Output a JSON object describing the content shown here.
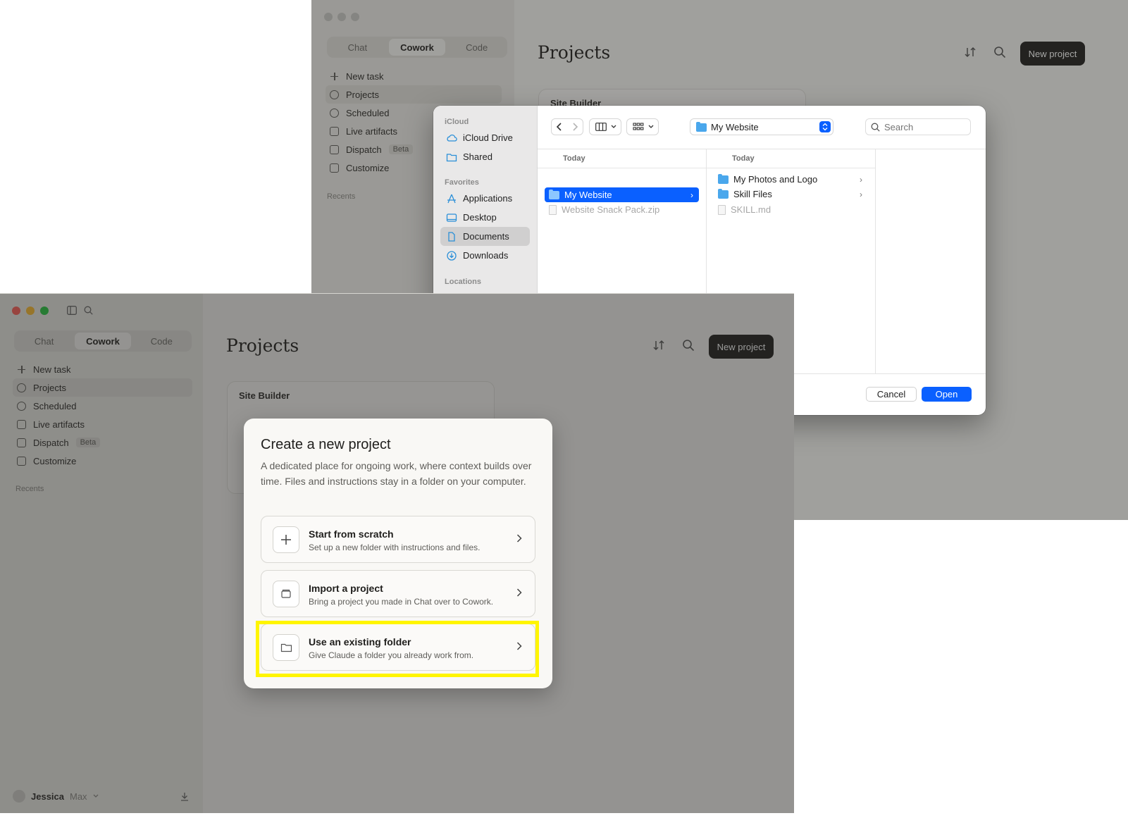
{
  "back_window": {
    "segments": [
      "Chat",
      "Cowork",
      "Code"
    ],
    "nav": [
      "New task",
      "Projects",
      "Scheduled",
      "Live artifacts",
      "Dispatch",
      "Customize"
    ],
    "beta_badge": "Beta",
    "recents_label": "Recents",
    "page_title": "Projects",
    "new_project_label": "New project",
    "card_title": "Site Builder"
  },
  "file_dialog": {
    "sidebar": {
      "icloud_header": "iCloud",
      "icloud_items": [
        "iCloud Drive",
        "Shared"
      ],
      "favorites_header": "Favorites",
      "favorite_items": [
        "Applications",
        "Desktop",
        "Documents",
        "Downloads"
      ],
      "locations_header": "Locations",
      "selected_item": "Documents"
    },
    "location": "My Website",
    "search_placeholder": "Search",
    "columns": [
      {
        "header": "Today",
        "items": [
          {
            "name": "My Website",
            "kind": "folder",
            "selected": true
          },
          {
            "name": "Website Snack Pack.zip",
            "kind": "file",
            "selected": false
          }
        ]
      },
      {
        "header": "Today",
        "items": [
          {
            "name": "My Photos and Logo",
            "kind": "folder",
            "selected": false
          },
          {
            "name": "Skill Files",
            "kind": "folder",
            "selected": false
          },
          {
            "name": "SKILL.md",
            "kind": "file",
            "selected": false
          }
        ]
      }
    ],
    "cancel_label": "Cancel",
    "open_label": "Open",
    "accent_color": "#0a60ff"
  },
  "front_window": {
    "segments": [
      "Chat",
      "Cowork",
      "Code"
    ],
    "nav": [
      "New task",
      "Projects",
      "Scheduled",
      "Live artifacts",
      "Dispatch",
      "Customize"
    ],
    "beta_badge": "Beta",
    "recents_label": "Recents",
    "page_title": "Projects",
    "new_project_label": "New project",
    "card_title": "Site Builder",
    "user_name": "Jessica",
    "user_plan": "Max"
  },
  "create_modal": {
    "title": "Create a new project",
    "description": "A dedicated place for ongoing work, where context builds over time. Files and instructions stay in a folder on your computer.",
    "options": [
      {
        "title": "Start from scratch",
        "subtitle": "Set up a new folder with instructions and files.",
        "icon": "plus-icon"
      },
      {
        "title": "Import a project",
        "subtitle": "Bring a project you made in Chat over to Cowork.",
        "icon": "archive-icon"
      },
      {
        "title": "Use an existing folder",
        "subtitle": "Give Claude a folder you already work from.",
        "icon": "folder-icon",
        "highlighted": true
      }
    ],
    "highlight_color": "#fff500"
  }
}
